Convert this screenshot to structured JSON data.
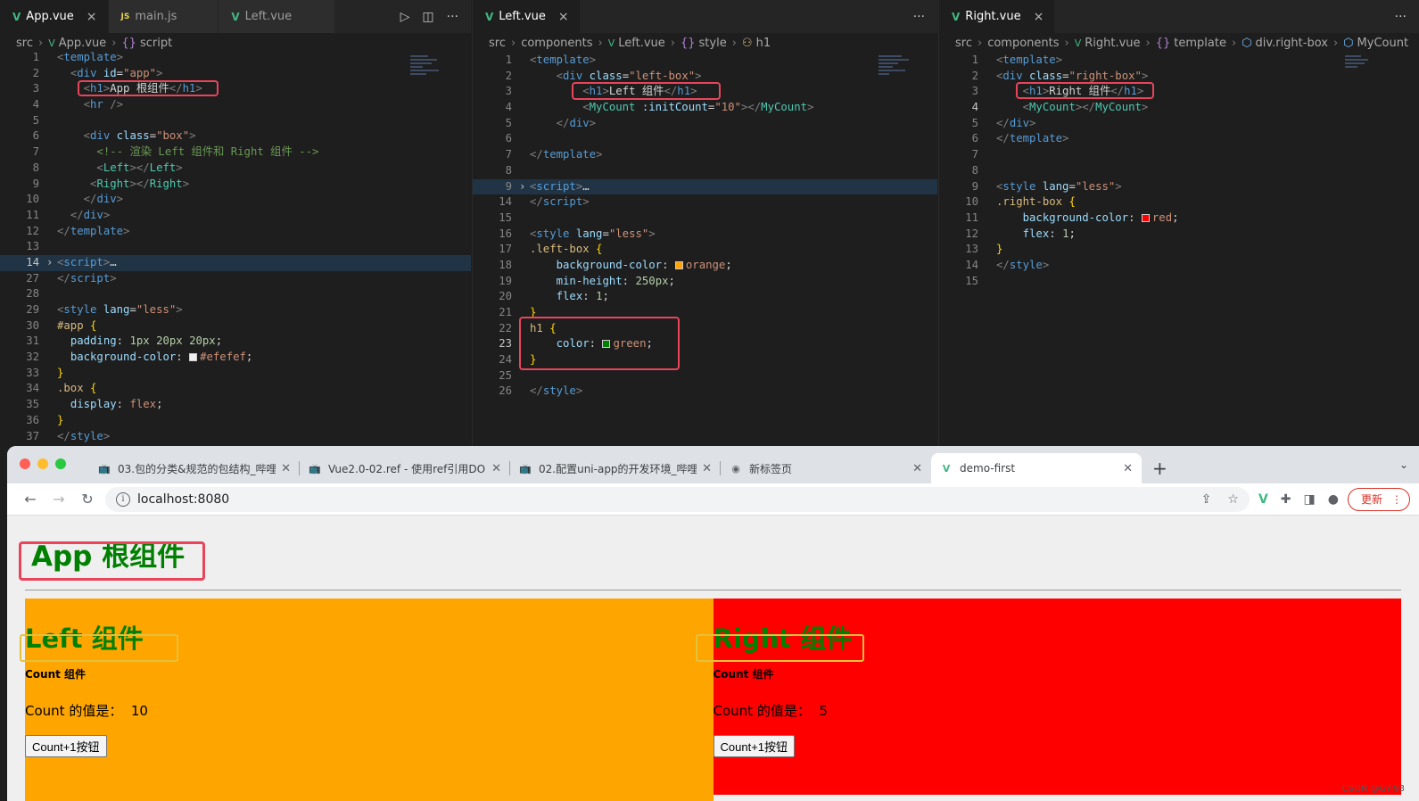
{
  "editors": {
    "app": {
      "tabs": [
        {
          "label": "App.vue",
          "icon": "vue-icon"
        },
        {
          "label": "main.js",
          "icon": "js-icon"
        },
        {
          "label": "Left.vue",
          "icon": "vue-icon"
        }
      ],
      "breadcrumb": [
        "src",
        "App.vue",
        "script"
      ],
      "lines": [
        {
          "n": "1",
          "h": "<span class='t-br'>&lt;</span><span class='t-tag'>template</span><span class='t-br'>&gt;</span>"
        },
        {
          "n": "2",
          "h": "  <span class='t-br'>&lt;</span><span class='t-tag'>div</span> <span class='t-attr'>id</span>=<span class='t-str'>\"app\"</span><span class='t-br'>&gt;</span>"
        },
        {
          "n": "3",
          "h": "    <span class='t-br'>&lt;</span><span class='t-tag'>h1</span><span class='t-br'>&gt;</span>App 根组件<span class='t-br'>&lt;/</span><span class='t-tag'>h1</span><span class='t-br'>&gt;</span>"
        },
        {
          "n": "4",
          "h": "    <span class='t-br'>&lt;</span><span class='t-tag'>hr</span> <span class='t-br'>/&gt;</span>"
        },
        {
          "n": "5",
          "h": ""
        },
        {
          "n": "6",
          "h": "    <span class='t-br'>&lt;</span><span class='t-tag'>div</span> <span class='t-attr'>class</span>=<span class='t-str'>\"box\"</span><span class='t-br'>&gt;</span>"
        },
        {
          "n": "7",
          "h": "      <span class='t-cmt'>&lt;!-- 渲染 Left 组件和 Right 组件 --&gt;</span>"
        },
        {
          "n": "8",
          "h": "      <span class='t-br'>&lt;</span><span class='t-comp'>Left</span><span class='t-br'>&gt;&lt;/</span><span class='t-comp'>Left</span><span class='t-br'>&gt;</span>"
        },
        {
          "n": "9",
          "h": "     <span class='t-br'>&lt;</span><span class='t-comp'>Right</span><span class='t-br'>&gt;&lt;/</span><span class='t-comp'>Right</span><span class='t-br'>&gt;</span>"
        },
        {
          "n": "10",
          "h": "    <span class='t-br'>&lt;/</span><span class='t-tag'>div</span><span class='t-br'>&gt;</span>"
        },
        {
          "n": "11",
          "h": "  <span class='t-br'>&lt;/</span><span class='t-tag'>div</span><span class='t-br'>&gt;</span>"
        },
        {
          "n": "12",
          "h": "<span class='t-br'>&lt;/</span><span class='t-tag'>template</span><span class='t-br'>&gt;</span>"
        },
        {
          "n": "13",
          "h": ""
        },
        {
          "n": "14",
          "h": "<span class='t-br'>&lt;</span><span class='t-tag'>script</span><span class='t-br'>&gt;</span><span class='t-plain'>…</span>",
          "fold": true,
          "cur": true
        },
        {
          "n": "27",
          "h": "<span class='t-br'>&lt;/</span><span class='t-tag'>script</span><span class='t-br'>&gt;</span>"
        },
        {
          "n": "28",
          "h": ""
        },
        {
          "n": "29",
          "h": "<span class='t-br'>&lt;</span><span class='t-tag'>style</span> <span class='t-attr'>lang</span>=<span class='t-str'>\"less\"</span><span class='t-br'>&gt;</span>"
        },
        {
          "n": "30",
          "h": "<span class='t-sel'>#app</span> <span class='t-brace'>{</span>"
        },
        {
          "n": "31",
          "h": "  <span class='t-prop'>padding</span>: <span class='t-num'>1px 20px 20px</span>;"
        },
        {
          "n": "32",
          "h": "  <span class='t-prop'>background-color</span>: <span class='swatch' style='background:#efefef'></span><span class='t-val'>#efefef</span>;"
        },
        {
          "n": "33",
          "h": "<span class='t-brace'>}</span>"
        },
        {
          "n": "34",
          "h": "<span class='t-sel'>.box</span> <span class='t-brace'>{</span>"
        },
        {
          "n": "35",
          "h": "  <span class='t-prop'>display</span>: <span class='t-val'>flex</span>;"
        },
        {
          "n": "36",
          "h": "<span class='t-brace'>}</span>"
        },
        {
          "n": "37",
          "h": "<span class='t-br'>&lt;/</span><span class='t-tag'>style</span><span class='t-br'>&gt;</span>"
        }
      ]
    },
    "left": {
      "tabs": [
        {
          "label": "Left.vue",
          "icon": "vue-icon"
        }
      ],
      "breadcrumb": [
        "src",
        "components",
        "Left.vue",
        "style",
        "h1"
      ],
      "lines": [
        {
          "n": "1",
          "h": "<span class='t-br'>&lt;</span><span class='t-tag'>template</span><span class='t-br'>&gt;</span>"
        },
        {
          "n": "2",
          "h": "    <span class='t-br'>&lt;</span><span class='t-tag'>div</span> <span class='t-attr'>class</span>=<span class='t-str'>\"left-box\"</span><span class='t-br'>&gt;</span>"
        },
        {
          "n": "3",
          "h": "        <span class='t-br'>&lt;</span><span class='t-tag'>h1</span><span class='t-br'>&gt;</span>Left 组件<span class='t-br'>&lt;/</span><span class='t-tag'>h1</span><span class='t-br'>&gt;</span>"
        },
        {
          "n": "4",
          "h": "        <span class='t-br'>&lt;</span><span class='t-comp'>MyCount</span> <span class='t-attr'>:initCount</span>=<span class='t-str'>\"10\"</span><span class='t-br'>&gt;&lt;/</span><span class='t-comp'>MyCount</span><span class='t-br'>&gt;</span>"
        },
        {
          "n": "5",
          "h": "    <span class='t-br'>&lt;/</span><span class='t-tag'>div</span><span class='t-br'>&gt;</span>"
        },
        {
          "n": "6",
          "h": ""
        },
        {
          "n": "7",
          "h": "<span class='t-br'>&lt;/</span><span class='t-tag'>template</span><span class='t-br'>&gt;</span>"
        },
        {
          "n": "8",
          "h": ""
        },
        {
          "n": "9",
          "h": "<span class='t-br'>&lt;</span><span class='t-tag'>script</span><span class='t-br'>&gt;</span><span class='t-plain'>…</span>",
          "fold": true
        },
        {
          "n": "14",
          "h": "<span class='t-br'>&lt;/</span><span class='t-tag'>script</span><span class='t-br'>&gt;</span>"
        },
        {
          "n": "15",
          "h": ""
        },
        {
          "n": "16",
          "h": "<span class='t-br'>&lt;</span><span class='t-tag'>style</span> <span class='t-attr'>lang</span>=<span class='t-str'>\"less\"</span><span class='t-br'>&gt;</span>"
        },
        {
          "n": "17",
          "h": "<span class='t-sel'>.left-box</span> <span class='t-brace'>{</span>"
        },
        {
          "n": "18",
          "h": "    <span class='t-prop'>background-color</span>: <span class='swatch' style='background:#ffa500'></span><span class='t-val'>orange</span>;"
        },
        {
          "n": "19",
          "h": "    <span class='t-prop'>min-height</span>: <span class='t-num'>250px</span>;"
        },
        {
          "n": "20",
          "h": "    <span class='t-prop'>flex</span>: <span class='t-num'>1</span>;"
        },
        {
          "n": "21",
          "h": "<span class='t-brace'>}</span>"
        },
        {
          "n": "22",
          "h": "<span class='t-sel'>h1</span> <span class='t-brace'>{</span>"
        },
        {
          "n": "23",
          "h": "    <span class='t-prop'>color</span>: <span class='swatch' style='background:#008000'></span><span class='t-val'>green</span>;",
          "cur": true
        },
        {
          "n": "24",
          "h": "<span class='t-brace'>}</span>"
        },
        {
          "n": "25",
          "h": ""
        },
        {
          "n": "26",
          "h": "<span class='t-br'>&lt;/</span><span class='t-tag'>style</span><span class='t-br'>&gt;</span>"
        }
      ]
    },
    "right": {
      "tabs": [
        {
          "label": "Right.vue",
          "icon": "vue-icon"
        }
      ],
      "breadcrumb": [
        "src",
        "components",
        "Right.vue",
        "template",
        "div.right-box",
        "MyCount"
      ],
      "lines": [
        {
          "n": "1",
          "h": "<span class='t-br'>&lt;</span><span class='t-tag'>template</span><span class='t-br'>&gt;</span>"
        },
        {
          "n": "2",
          "h": "<span class='t-br'>&lt;</span><span class='t-tag'>div</span> <span class='t-attr'>class</span>=<span class='t-str'>\"right-box\"</span><span class='t-br'>&gt;</span>"
        },
        {
          "n": "3",
          "h": "    <span class='t-br'>&lt;</span><span class='t-tag'>h1</span><span class='t-br'>&gt;</span>Right 组件<span class='t-br'>&lt;/</span><span class='t-tag'>h1</span><span class='t-br'>&gt;</span>"
        },
        {
          "n": "4",
          "h": "    <span class='t-br'>&lt;</span><span class='t-comp'>MyCount</span><span class='t-br'>&gt;&lt;/</span><span class='t-comp'>MyCount</span><span class='t-br'>&gt;</span>",
          "cur": true
        },
        {
          "n": "5",
          "h": "<span class='t-br'>&lt;/</span><span class='t-tag'>div</span><span class='t-br'>&gt;</span>"
        },
        {
          "n": "6",
          "h": "<span class='t-br'>&lt;/</span><span class='t-tag'>template</span><span class='t-br'>&gt;</span>"
        },
        {
          "n": "7",
          "h": ""
        },
        {
          "n": "8",
          "h": ""
        },
        {
          "n": "9",
          "h": "<span class='t-br'>&lt;</span><span class='t-tag'>style</span> <span class='t-attr'>lang</span>=<span class='t-str'>\"less\"</span><span class='t-br'>&gt;</span>"
        },
        {
          "n": "10",
          "h": "<span class='t-sel'>.right-box</span> <span class='t-brace'>{</span>"
        },
        {
          "n": "11",
          "h": "    <span class='t-prop'>background-color</span>: <span class='swatch' style='background:#ff0000'></span><span class='t-val'>red</span>;"
        },
        {
          "n": "12",
          "h": "    <span class='t-prop'>flex</span>: <span class='t-num'>1</span>;"
        },
        {
          "n": "13",
          "h": "<span class='t-brace'>}</span>"
        },
        {
          "n": "14",
          "h": "<span class='t-br'>&lt;/</span><span class='t-tag'>style</span><span class='t-br'>&gt;</span>"
        },
        {
          "n": "15",
          "h": ""
        }
      ]
    }
  },
  "browser": {
    "tabs": [
      {
        "label": "03.包的分类&规范的包结构_哔哩",
        "favicon": "bilibili-icon"
      },
      {
        "label": "Vue2.0-02.ref - 使用ref引用DO",
        "favicon": "bilibili-icon"
      },
      {
        "label": "02.配置uni-app的开发环境_哔哩",
        "favicon": "bilibili-icon"
      },
      {
        "label": "新标签页",
        "favicon": "chrome-icon"
      },
      {
        "label": "demo-first",
        "favicon": "vue-icon",
        "active": true
      }
    ],
    "url": "localhost:8080",
    "update_label": "更新"
  },
  "page": {
    "app_title": "App 根组件",
    "left": {
      "title": "Left 组件",
      "count_title": "Count 组件",
      "count_label": "Count 的值是：",
      "count_value": "10",
      "button": "Count+1按钮"
    },
    "right": {
      "title": "Right 组件",
      "count_title": "Count 组件",
      "count_label": "Count 的值是：",
      "count_value": "5",
      "button": "Count+1按钮"
    },
    "watermark": "CSDN @GY-93"
  },
  "colors": {
    "left_box": "#ffa500",
    "right_box": "#ff0000",
    "h1": "#008000",
    "page_bg": "#efefef",
    "highlight_red": "#e8455a"
  }
}
